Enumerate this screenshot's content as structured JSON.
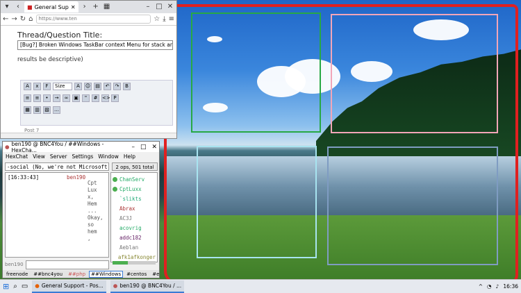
{
  "browser": {
    "tab_title": "General Sup",
    "url": "https://www.ten",
    "thread_title_label": "Thread/Question Title:",
    "title_value": "[Bug?] Broken Windows TaskBar context Menu for stack and sid",
    "hint_text": "results be descriptive)",
    "font_size_select": "Size",
    "post_selector": "Post 7"
  },
  "hexchat": {
    "window_title": "ben190 @ BNC4You / ##Windows - HexCha...",
    "menu": [
      "HexChat",
      "View",
      "Server",
      "Settings",
      "Window",
      "Help"
    ],
    "topic": "-social (No, we're not Microsoft)",
    "ops_count": "2 ops, 501 total",
    "log_time": "[16:33:43]",
    "log_nick": "ben190",
    "log_message": "Cpt Lux x, Hem ... Okay, so hem ,",
    "users": [
      "ChanServ",
      "CptLuxx",
      "`slikts",
      "Abrax",
      "AC3J",
      "acovrig",
      "addc182",
      "Aeblan",
      "afk1afkonger"
    ],
    "input_nick": "ben190",
    "tabs": [
      "freenode",
      "##bnc4you",
      "##php",
      "##Windows",
      "#centos",
      "#exim"
    ]
  },
  "taskbar": {
    "item1": "General Support - Pos...",
    "item2": "ben190 @ BNC4You / ...",
    "clock": "16:36"
  },
  "zones": {
    "green": "#27a844",
    "pink": "#f2a6b8",
    "cyan": "#a8e4f0",
    "steel": "#7f9cc2",
    "red": "#e02020"
  }
}
